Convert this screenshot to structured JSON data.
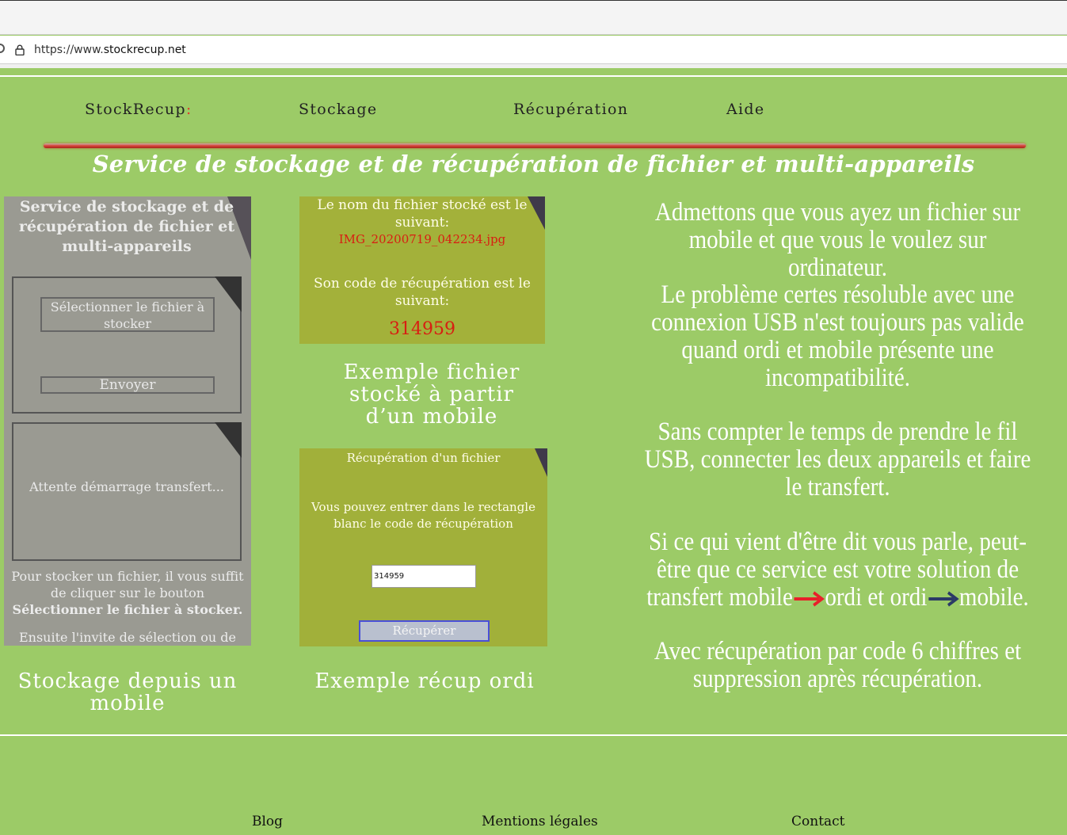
{
  "browser": {
    "url_prefix": "https://www.",
    "url_host": "stockrecup.net"
  },
  "nav": {
    "brand": "StockRecup",
    "brand_colon": ":",
    "items": [
      "Stockage",
      "Récupération",
      "Aide"
    ]
  },
  "page_title": "Service de stockage et de récupération de fichier et multi-appareils",
  "phone": {
    "title": "Service de stockage et de récupération de fichier et multi-appareils",
    "select_button": "Sélectionner le fichier à stocker",
    "send_button": "Envoyer",
    "waiting": "Attente démarrage transfert...",
    "help_line1": "Pour stocker un fichier, il vous suffit de cliquer sur le bouton",
    "help_bold": "Sélectionner le fichier à stocker.",
    "help_line2": "Ensuite l'invite de sélection ou de",
    "caption": "Stockage depuis un mobile"
  },
  "stored": {
    "text1": "Le nom du fichier stocké est le suivant:",
    "filename": "IMG_20200719_042234.jpg",
    "text2": "Son code de récupération est le suivant:",
    "code": "314959",
    "caption": "Exemple fichier stocké à partir d’un mobile"
  },
  "recup": {
    "title": "Récupération d'un fichier",
    "instructions": "Vous pouvez entrer dans le rectangle blanc le code de récupération",
    "input_value": "314959",
    "button": "Récupérer",
    "caption": "Exemple récup ordi"
  },
  "description": {
    "p1": "Admettons que vous ayez un fichier sur mobile et que vous le voulez sur ordinateur.",
    "p2": "Le problème certes résoluble avec une connexion USB n'est toujours pas valide quand ordi et mobile présente une incompatibilité.",
    "p3": "Sans compter le temps de prendre le fil USB, connecter les deux appareils et faire le transfert.",
    "p4_start": "Si ce qui vient d'être dit vous parle, peut-être que ce service est votre solution de transfert",
    "p4_mobile1": "mobile",
    "p4_mid": "ordi et ordi",
    "p4_mobile2": "mobile.",
    "p5": "Avec récupération par code 6 chiffres et suppression après récupération.",
    "arrow1_color": "#e8202a",
    "arrow2_color": "#2b3a66"
  },
  "footer": {
    "links": [
      "Blog",
      "Mentions légales",
      "Contact"
    ]
  }
}
